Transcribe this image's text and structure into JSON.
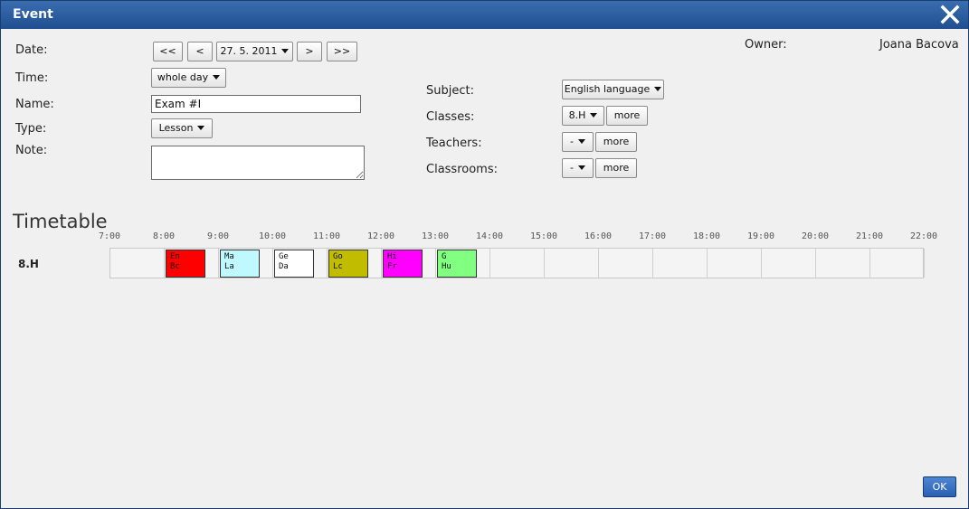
{
  "dialog": {
    "title": "Event",
    "close_icon": "close-icon"
  },
  "form": {
    "date_label": "Date:",
    "date_first": "<<",
    "date_prev": "<",
    "date_value": "27. 5. 2011",
    "date_next": ">",
    "date_last": ">>",
    "time_label": "Time:",
    "time_value": "whole day",
    "name_label": "Name:",
    "name_value": "Exam #I",
    "type_label": "Type:",
    "type_value": "Lesson",
    "note_label": "Note:",
    "note_value": "",
    "owner_label": "Owner:",
    "owner_value": "Joana Bacova",
    "subject_label": "Subject:",
    "subject_value": "English language",
    "classes_label": "Classes:",
    "classes_value": "8.H",
    "classes_more": "more",
    "teachers_label": "Teachers:",
    "teachers_value": "-",
    "teachers_more": "more",
    "classrooms_label": "Classrooms:",
    "classrooms_value": "-",
    "classrooms_more": "more"
  },
  "timetable": {
    "title": "Timetable",
    "hours": [
      "7:00",
      "8:00",
      "9:00",
      "10:00",
      "11:00",
      "12:00",
      "13:00",
      "14:00",
      "15:00",
      "16:00",
      "17:00",
      "18:00",
      "19:00",
      "20:00",
      "21:00",
      "22:00"
    ],
    "row_label": "8.H",
    "lessons": [
      {
        "subject": "En",
        "teacher": "Bc",
        "color": "#ff0000"
      },
      {
        "subject": "Ma",
        "teacher": "La",
        "color": "#bff9ff"
      },
      {
        "subject": "Ge",
        "teacher": "Da",
        "color": "#ffffff"
      },
      {
        "subject": "Go",
        "teacher": "Lc",
        "color": "#c2bc00"
      },
      {
        "subject": "Hi",
        "teacher": "Fr",
        "color": "#ff00ff"
      },
      {
        "subject": "G",
        "teacher": "Hu",
        "color": "#80ff80"
      }
    ]
  },
  "footer": {
    "ok_label": "OK"
  }
}
